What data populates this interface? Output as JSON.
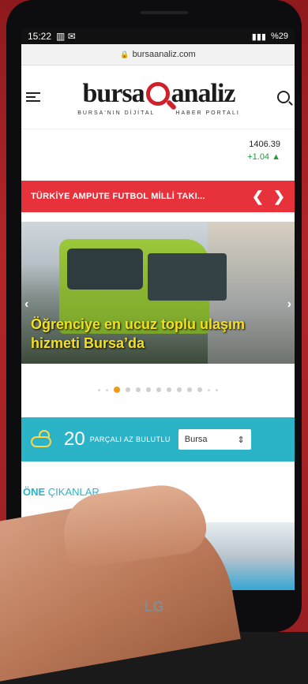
{
  "status_bar": {
    "time": "15:22",
    "left_icons": "▥ ✉",
    "battery": "%29"
  },
  "browser": {
    "url": "bursaanaliz.com"
  },
  "site": {
    "logo_left": "bursa",
    "logo_right": "analiz",
    "tagline_left": "BURSA'NIN DİJİTAL",
    "tagline_right": "HABER PORTALI"
  },
  "ticker": {
    "value": "1406.39",
    "change": "+1.04 ▲"
  },
  "news_bar": {
    "title": "TÜRKİYE AMPUTE FUTBOL MİLLİ TAKI...",
    "prev": "❮",
    "next": "❯"
  },
  "slider": {
    "caption": "Öğrenciye en ucuz toplu ulaşım hizmeti Bursa’da",
    "prev": "‹",
    "next": "›"
  },
  "weather": {
    "temperature": "20",
    "condition": "PARÇALI AZ BULUTLU",
    "city": "Bursa",
    "select_arrow": "⇕"
  },
  "section": {
    "title_bold": "ÖNE",
    "title_rest": "ÇIKANLAR"
  },
  "device": {
    "brand": "LG"
  },
  "colors": {
    "accent_red": "#e8323b",
    "weather_bg": "#2bb3c7",
    "slider_active_dot": "#f29a1c",
    "caption_yellow": "#f5e11a"
  }
}
